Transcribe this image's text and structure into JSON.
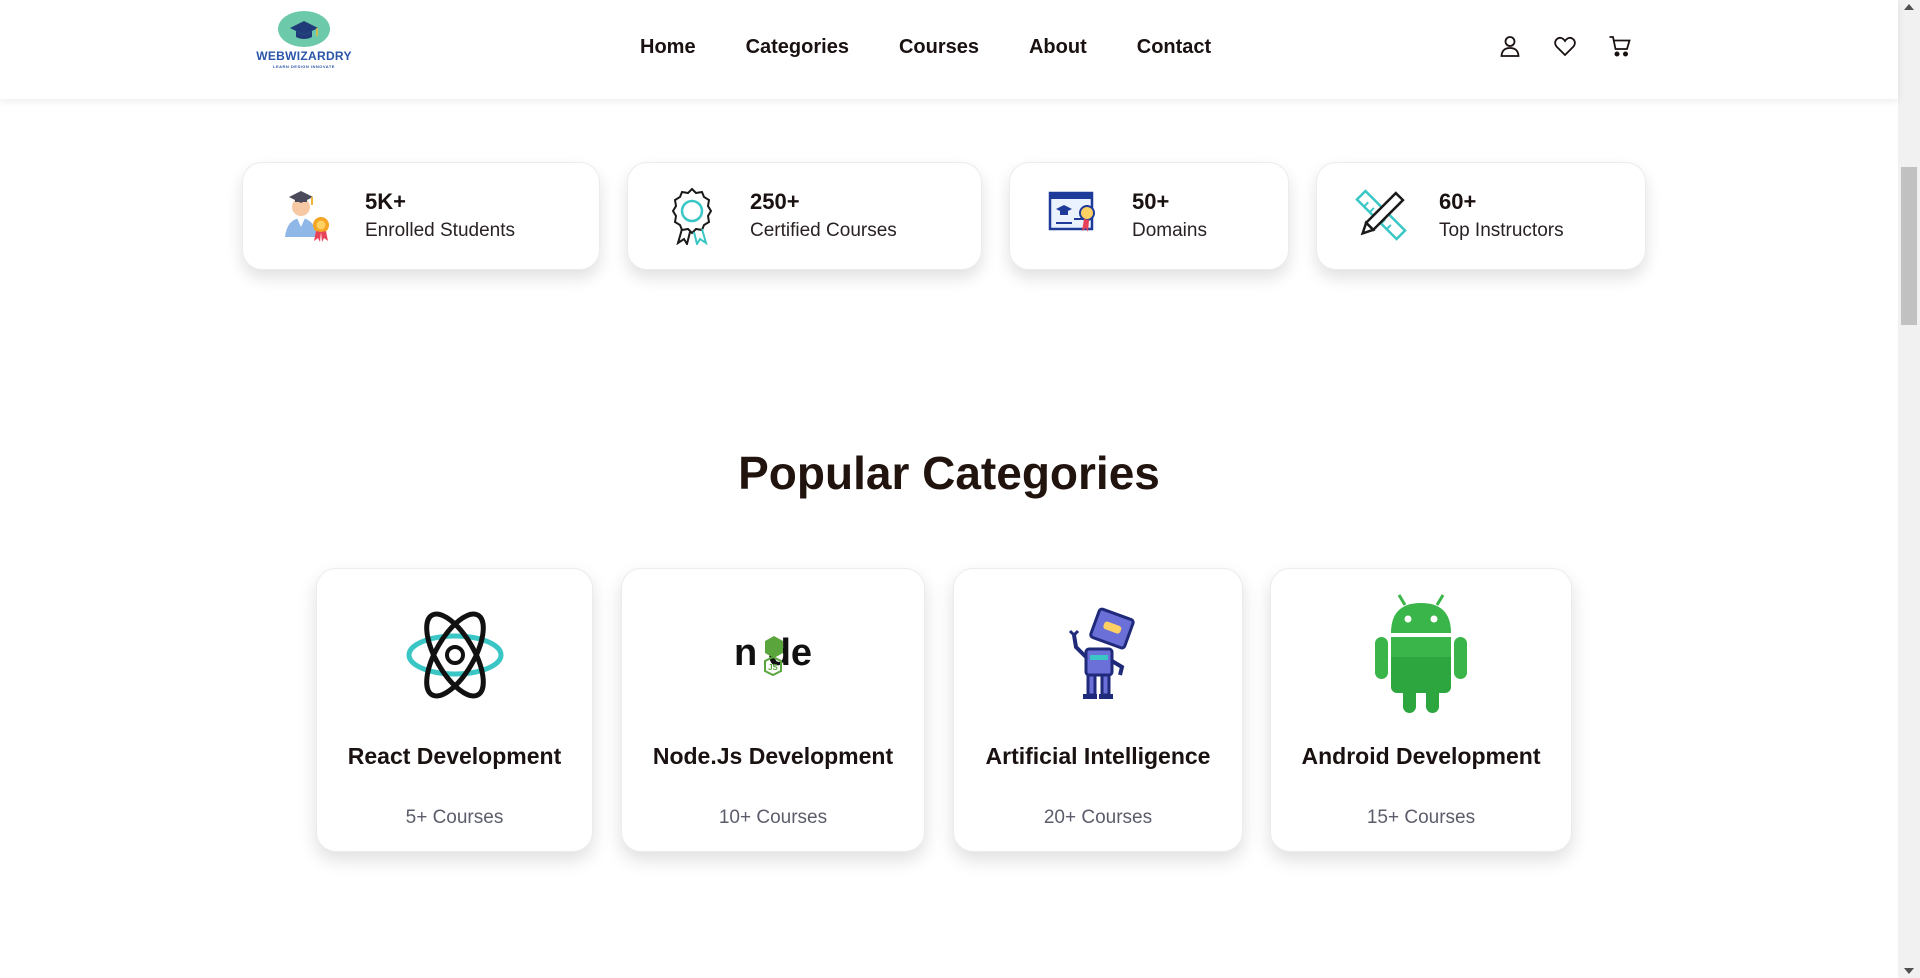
{
  "brand": {
    "name": "WEBWIZARDRY",
    "tagline": "LEARN DESIGN INNOVATE"
  },
  "nav": [
    "Home",
    "Categories",
    "Courses",
    "About",
    "Contact"
  ],
  "header_icons": [
    "user-icon",
    "heart-icon",
    "cart-icon"
  ],
  "stats": [
    {
      "value": "5K+",
      "label": "Enrolled Students",
      "icon": "graduate-student-icon"
    },
    {
      "value": "250+",
      "label": "Certified Courses",
      "icon": "certificate-badge-icon"
    },
    {
      "value": "50+",
      "label": "Domains",
      "icon": "online-course-icon"
    },
    {
      "value": "60+",
      "label": "Top Instructors",
      "icon": "ruler-pencil-icon"
    }
  ],
  "section": {
    "title": "Popular Categories"
  },
  "categories": [
    {
      "name": "React Development",
      "count": "5+ Courses",
      "icon": "react-icon"
    },
    {
      "name": "Node.Js Development",
      "count": "10+ Courses",
      "icon": "nodejs-icon"
    },
    {
      "name": "Artificial Intelligence",
      "count": "20+ Courses",
      "icon": "robot-icon"
    },
    {
      "name": "Android Development",
      "count": "15+ Courses",
      "icon": "android-icon"
    }
  ],
  "colors": {
    "title": "#21140f",
    "muted": "#5b5d6b",
    "logo_blue": "#2a55a8",
    "logo_teal": "#6cc9a9",
    "android_green": "#3ab54a"
  }
}
